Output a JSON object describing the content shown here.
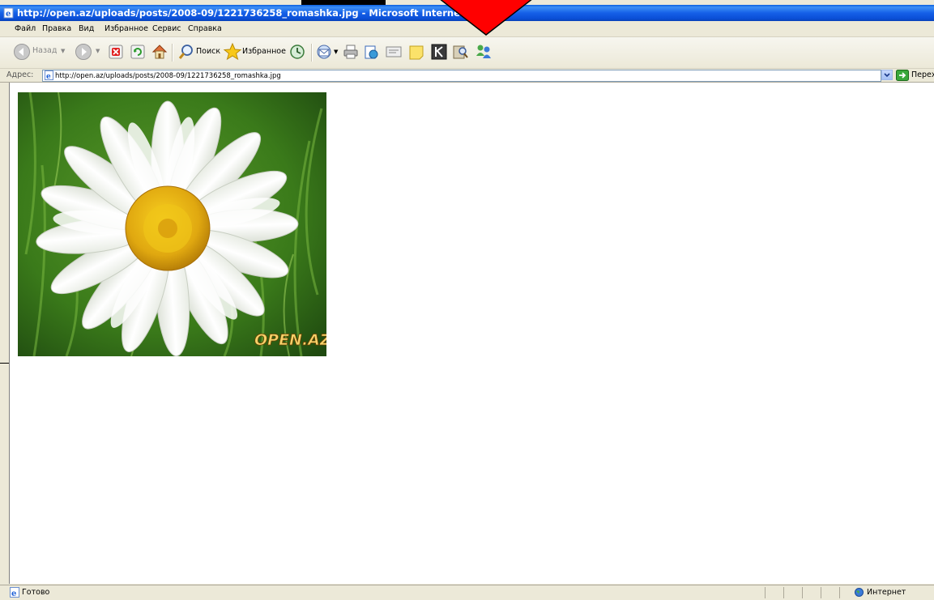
{
  "window": {
    "title": "http://open.az/uploads/posts/2008-09/1221736258_romashka.jpg - Microsoft Internet Explorer"
  },
  "menu": {
    "items": [
      "Файл",
      "Правка",
      "Вид",
      "Избранное",
      "Сервис",
      "Справка"
    ]
  },
  "toolbar": {
    "back_label": "Назад",
    "search_label": "Поиск",
    "favorites_label": "Избранное"
  },
  "address": {
    "label": "Адрес:",
    "url": "http://open.az/uploads/posts/2008-09/1221736258_romashka.jpg",
    "go_label": "Перех"
  },
  "content": {
    "watermark": "OPEN.AZ"
  },
  "status": {
    "text": "Готово",
    "zone": "Интернет"
  },
  "colors": {
    "titlebar": "#0a5fe0",
    "arrow": "#ff0000"
  }
}
